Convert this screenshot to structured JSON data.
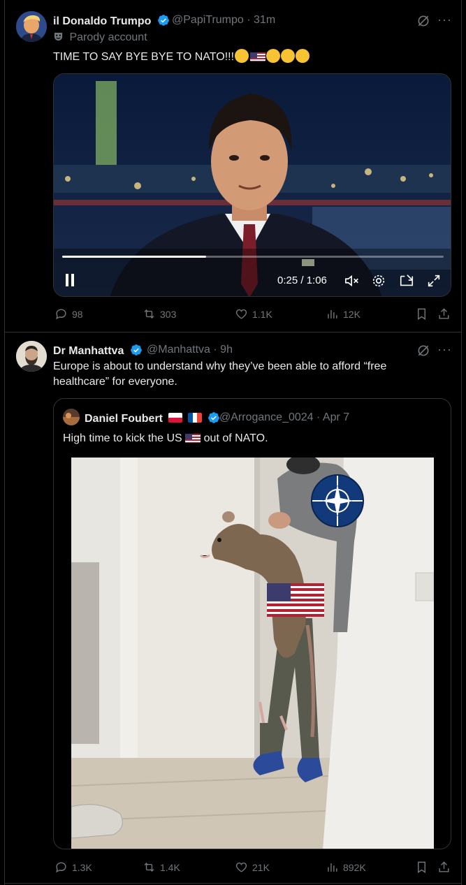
{
  "tweet1": {
    "name": "il Donaldo Trumpo",
    "handle": "@PapiTrumpo",
    "time": "· 31m",
    "label": "Parody account",
    "text": "TIME TO SAY BYE BYE TO NATO!!!",
    "video": {
      "timestamp": "0:25 / 1:06",
      "progress": 0.378
    },
    "stats": {
      "replies": "98",
      "reposts": "303",
      "likes": "1.1K",
      "views": "12K"
    }
  },
  "tweet2": {
    "name": "Dr Manhattva",
    "handle": "@Manhattva",
    "time": "· 9h",
    "text_line1": "Europe is about to understand why they’ve been able to afford “free",
    "text_line2": "healthcare” for everyone.",
    "stats": {
      "replies": "1.3K",
      "reposts": "1.4K",
      "likes": "21K",
      "views": "892K"
    },
    "quote": {
      "name": "Daniel Foubert",
      "handle": "@Arrogance_0024",
      "time": "· Apr 7",
      "text_before": "High time to kick the US",
      "text_after": "out of NATO."
    }
  },
  "colors": {
    "background": "#000000",
    "text": "#e7e9ea",
    "muted": "#71767b",
    "border": "#2f3336",
    "verified": "#1d9bf0"
  }
}
